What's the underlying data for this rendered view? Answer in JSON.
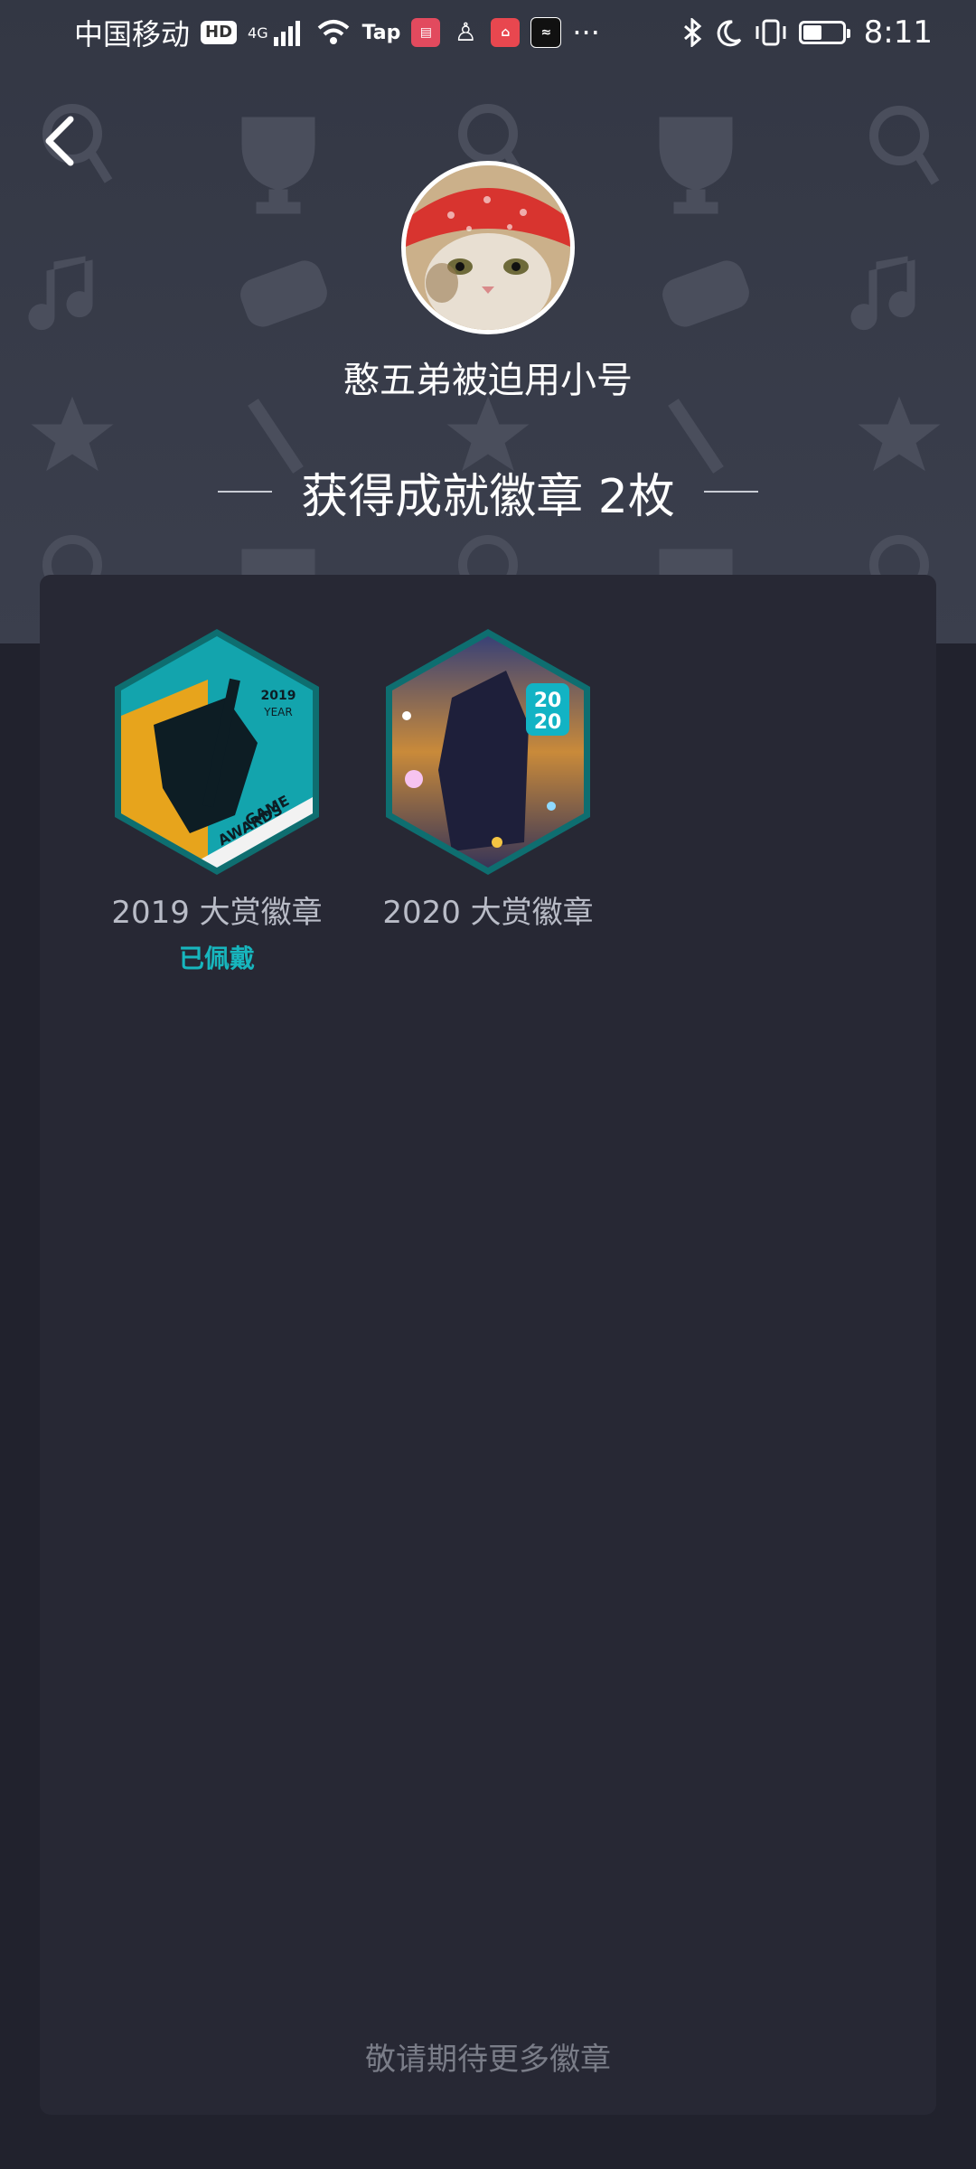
{
  "status_bar": {
    "carrier": "中国移动",
    "hd": "HD",
    "network": "4G",
    "tap_app": "Tap",
    "more": "···",
    "time": "8:11"
  },
  "profile": {
    "username": "憨五弟被迫用小号"
  },
  "badges_header": {
    "title": "获得成就徽章 2枚"
  },
  "badges": [
    {
      "name": "2019 大赏徽章",
      "status": "已佩戴",
      "art_text": [
        "2019",
        "YEAR",
        "GAME",
        "AWARDS"
      ]
    },
    {
      "name": "2020 大赏徽章",
      "status": "",
      "art_text": [
        "20",
        "20"
      ]
    }
  ],
  "footer": {
    "note": "敬请期待更多徽章"
  },
  "colors": {
    "header_bg": "#373b48",
    "page_bg": "#21222d",
    "card_bg": "#272834",
    "accent": "#17b6be"
  },
  "icons": [
    "back-arrow-icon",
    "bluetooth-icon",
    "moon-icon",
    "vibrate-icon",
    "battery-icon",
    "wifi-icon",
    "signal-icon"
  ]
}
